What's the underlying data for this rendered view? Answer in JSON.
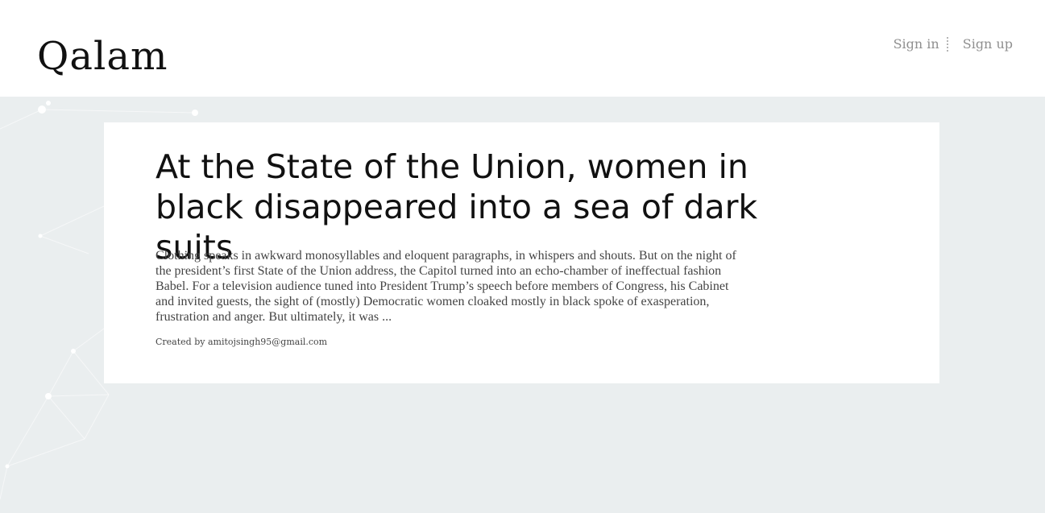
{
  "header": {
    "brand": "Qalam",
    "sign_in": "Sign in",
    "sign_up": "Sign up"
  },
  "article": {
    "title": "At the State of the Union, women in black disappeared into a sea of dark suits",
    "excerpt": "Clothing speaks in awkward monosyllables and eloquent paragraphs, in whispers and shouts. But on the night of the president’s first State of the Union address, the Capitol turned into an echo-chamber of ineffectual fashion Babel. For a television audience tuned into President Trump’s speech before members of Congress, his Cabinet and invited guests, the sight of (mostly) Democratic women cloaked mostly in black spoke of exasperation, frustration and anger. But ultimately, it was ...",
    "author_line": "Created by amitojsingh95@gmail.com"
  },
  "colors": {
    "background": "#eaeeef",
    "card": "#ffffff",
    "header": "#ffffff",
    "link_muted": "#8f8f8f"
  }
}
